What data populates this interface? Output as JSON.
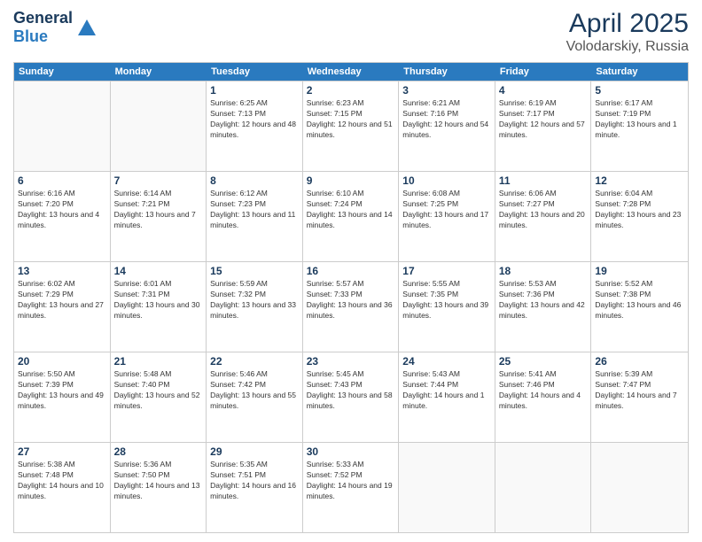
{
  "header": {
    "logo_general": "General",
    "logo_blue": "Blue",
    "title": "April 2025",
    "location": "Volodarskiy, Russia"
  },
  "days_of_week": [
    "Sunday",
    "Monday",
    "Tuesday",
    "Wednesday",
    "Thursday",
    "Friday",
    "Saturday"
  ],
  "weeks": [
    [
      {
        "day": "",
        "info": ""
      },
      {
        "day": "",
        "info": ""
      },
      {
        "day": "1",
        "info": "Sunrise: 6:25 AM\nSunset: 7:13 PM\nDaylight: 12 hours and 48 minutes."
      },
      {
        "day": "2",
        "info": "Sunrise: 6:23 AM\nSunset: 7:15 PM\nDaylight: 12 hours and 51 minutes."
      },
      {
        "day": "3",
        "info": "Sunrise: 6:21 AM\nSunset: 7:16 PM\nDaylight: 12 hours and 54 minutes."
      },
      {
        "day": "4",
        "info": "Sunrise: 6:19 AM\nSunset: 7:17 PM\nDaylight: 12 hours and 57 minutes."
      },
      {
        "day": "5",
        "info": "Sunrise: 6:17 AM\nSunset: 7:19 PM\nDaylight: 13 hours and 1 minute."
      }
    ],
    [
      {
        "day": "6",
        "info": "Sunrise: 6:16 AM\nSunset: 7:20 PM\nDaylight: 13 hours and 4 minutes."
      },
      {
        "day": "7",
        "info": "Sunrise: 6:14 AM\nSunset: 7:21 PM\nDaylight: 13 hours and 7 minutes."
      },
      {
        "day": "8",
        "info": "Sunrise: 6:12 AM\nSunset: 7:23 PM\nDaylight: 13 hours and 11 minutes."
      },
      {
        "day": "9",
        "info": "Sunrise: 6:10 AM\nSunset: 7:24 PM\nDaylight: 13 hours and 14 minutes."
      },
      {
        "day": "10",
        "info": "Sunrise: 6:08 AM\nSunset: 7:25 PM\nDaylight: 13 hours and 17 minutes."
      },
      {
        "day": "11",
        "info": "Sunrise: 6:06 AM\nSunset: 7:27 PM\nDaylight: 13 hours and 20 minutes."
      },
      {
        "day": "12",
        "info": "Sunrise: 6:04 AM\nSunset: 7:28 PM\nDaylight: 13 hours and 23 minutes."
      }
    ],
    [
      {
        "day": "13",
        "info": "Sunrise: 6:02 AM\nSunset: 7:29 PM\nDaylight: 13 hours and 27 minutes."
      },
      {
        "day": "14",
        "info": "Sunrise: 6:01 AM\nSunset: 7:31 PM\nDaylight: 13 hours and 30 minutes."
      },
      {
        "day": "15",
        "info": "Sunrise: 5:59 AM\nSunset: 7:32 PM\nDaylight: 13 hours and 33 minutes."
      },
      {
        "day": "16",
        "info": "Sunrise: 5:57 AM\nSunset: 7:33 PM\nDaylight: 13 hours and 36 minutes."
      },
      {
        "day": "17",
        "info": "Sunrise: 5:55 AM\nSunset: 7:35 PM\nDaylight: 13 hours and 39 minutes."
      },
      {
        "day": "18",
        "info": "Sunrise: 5:53 AM\nSunset: 7:36 PM\nDaylight: 13 hours and 42 minutes."
      },
      {
        "day": "19",
        "info": "Sunrise: 5:52 AM\nSunset: 7:38 PM\nDaylight: 13 hours and 46 minutes."
      }
    ],
    [
      {
        "day": "20",
        "info": "Sunrise: 5:50 AM\nSunset: 7:39 PM\nDaylight: 13 hours and 49 minutes."
      },
      {
        "day": "21",
        "info": "Sunrise: 5:48 AM\nSunset: 7:40 PM\nDaylight: 13 hours and 52 minutes."
      },
      {
        "day": "22",
        "info": "Sunrise: 5:46 AM\nSunset: 7:42 PM\nDaylight: 13 hours and 55 minutes."
      },
      {
        "day": "23",
        "info": "Sunrise: 5:45 AM\nSunset: 7:43 PM\nDaylight: 13 hours and 58 minutes."
      },
      {
        "day": "24",
        "info": "Sunrise: 5:43 AM\nSunset: 7:44 PM\nDaylight: 14 hours and 1 minute."
      },
      {
        "day": "25",
        "info": "Sunrise: 5:41 AM\nSunset: 7:46 PM\nDaylight: 14 hours and 4 minutes."
      },
      {
        "day": "26",
        "info": "Sunrise: 5:39 AM\nSunset: 7:47 PM\nDaylight: 14 hours and 7 minutes."
      }
    ],
    [
      {
        "day": "27",
        "info": "Sunrise: 5:38 AM\nSunset: 7:48 PM\nDaylight: 14 hours and 10 minutes."
      },
      {
        "day": "28",
        "info": "Sunrise: 5:36 AM\nSunset: 7:50 PM\nDaylight: 14 hours and 13 minutes."
      },
      {
        "day": "29",
        "info": "Sunrise: 5:35 AM\nSunset: 7:51 PM\nDaylight: 14 hours and 16 minutes."
      },
      {
        "day": "30",
        "info": "Sunrise: 5:33 AM\nSunset: 7:52 PM\nDaylight: 14 hours and 19 minutes."
      },
      {
        "day": "",
        "info": ""
      },
      {
        "day": "",
        "info": ""
      },
      {
        "day": "",
        "info": ""
      }
    ]
  ]
}
